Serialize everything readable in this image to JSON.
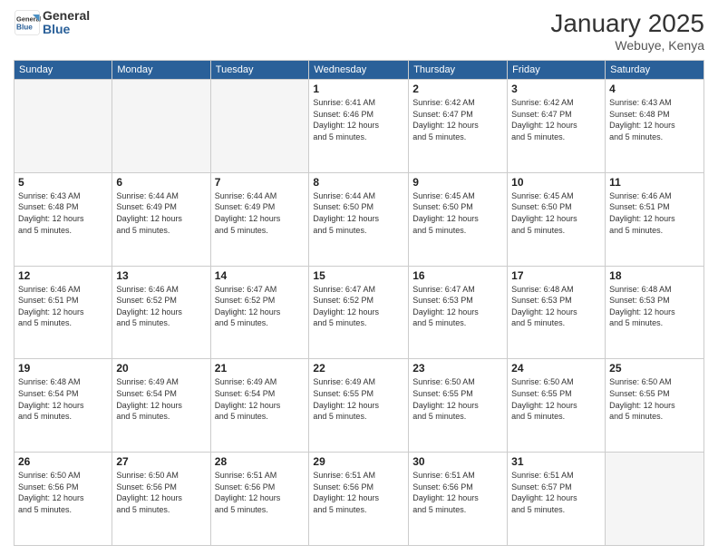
{
  "header": {
    "logo_line1": "General",
    "logo_line2": "Blue",
    "month": "January 2025",
    "location": "Webuye, Kenya"
  },
  "weekdays": [
    "Sunday",
    "Monday",
    "Tuesday",
    "Wednesday",
    "Thursday",
    "Friday",
    "Saturday"
  ],
  "weeks": [
    [
      {
        "day": "",
        "info": ""
      },
      {
        "day": "",
        "info": ""
      },
      {
        "day": "",
        "info": ""
      },
      {
        "day": "1",
        "info": "Sunrise: 6:41 AM\nSunset: 6:46 PM\nDaylight: 12 hours\nand 5 minutes."
      },
      {
        "day": "2",
        "info": "Sunrise: 6:42 AM\nSunset: 6:47 PM\nDaylight: 12 hours\nand 5 minutes."
      },
      {
        "day": "3",
        "info": "Sunrise: 6:42 AM\nSunset: 6:47 PM\nDaylight: 12 hours\nand 5 minutes."
      },
      {
        "day": "4",
        "info": "Sunrise: 6:43 AM\nSunset: 6:48 PM\nDaylight: 12 hours\nand 5 minutes."
      }
    ],
    [
      {
        "day": "5",
        "info": "Sunrise: 6:43 AM\nSunset: 6:48 PM\nDaylight: 12 hours\nand 5 minutes."
      },
      {
        "day": "6",
        "info": "Sunrise: 6:44 AM\nSunset: 6:49 PM\nDaylight: 12 hours\nand 5 minutes."
      },
      {
        "day": "7",
        "info": "Sunrise: 6:44 AM\nSunset: 6:49 PM\nDaylight: 12 hours\nand 5 minutes."
      },
      {
        "day": "8",
        "info": "Sunrise: 6:44 AM\nSunset: 6:50 PM\nDaylight: 12 hours\nand 5 minutes."
      },
      {
        "day": "9",
        "info": "Sunrise: 6:45 AM\nSunset: 6:50 PM\nDaylight: 12 hours\nand 5 minutes."
      },
      {
        "day": "10",
        "info": "Sunrise: 6:45 AM\nSunset: 6:50 PM\nDaylight: 12 hours\nand 5 minutes."
      },
      {
        "day": "11",
        "info": "Sunrise: 6:46 AM\nSunset: 6:51 PM\nDaylight: 12 hours\nand 5 minutes."
      }
    ],
    [
      {
        "day": "12",
        "info": "Sunrise: 6:46 AM\nSunset: 6:51 PM\nDaylight: 12 hours\nand 5 minutes."
      },
      {
        "day": "13",
        "info": "Sunrise: 6:46 AM\nSunset: 6:52 PM\nDaylight: 12 hours\nand 5 minutes."
      },
      {
        "day": "14",
        "info": "Sunrise: 6:47 AM\nSunset: 6:52 PM\nDaylight: 12 hours\nand 5 minutes."
      },
      {
        "day": "15",
        "info": "Sunrise: 6:47 AM\nSunset: 6:52 PM\nDaylight: 12 hours\nand 5 minutes."
      },
      {
        "day": "16",
        "info": "Sunrise: 6:47 AM\nSunset: 6:53 PM\nDaylight: 12 hours\nand 5 minutes."
      },
      {
        "day": "17",
        "info": "Sunrise: 6:48 AM\nSunset: 6:53 PM\nDaylight: 12 hours\nand 5 minutes."
      },
      {
        "day": "18",
        "info": "Sunrise: 6:48 AM\nSunset: 6:53 PM\nDaylight: 12 hours\nand 5 minutes."
      }
    ],
    [
      {
        "day": "19",
        "info": "Sunrise: 6:48 AM\nSunset: 6:54 PM\nDaylight: 12 hours\nand 5 minutes."
      },
      {
        "day": "20",
        "info": "Sunrise: 6:49 AM\nSunset: 6:54 PM\nDaylight: 12 hours\nand 5 minutes."
      },
      {
        "day": "21",
        "info": "Sunrise: 6:49 AM\nSunset: 6:54 PM\nDaylight: 12 hours\nand 5 minutes."
      },
      {
        "day": "22",
        "info": "Sunrise: 6:49 AM\nSunset: 6:55 PM\nDaylight: 12 hours\nand 5 minutes."
      },
      {
        "day": "23",
        "info": "Sunrise: 6:50 AM\nSunset: 6:55 PM\nDaylight: 12 hours\nand 5 minutes."
      },
      {
        "day": "24",
        "info": "Sunrise: 6:50 AM\nSunset: 6:55 PM\nDaylight: 12 hours\nand 5 minutes."
      },
      {
        "day": "25",
        "info": "Sunrise: 6:50 AM\nSunset: 6:55 PM\nDaylight: 12 hours\nand 5 minutes."
      }
    ],
    [
      {
        "day": "26",
        "info": "Sunrise: 6:50 AM\nSunset: 6:56 PM\nDaylight: 12 hours\nand 5 minutes."
      },
      {
        "day": "27",
        "info": "Sunrise: 6:50 AM\nSunset: 6:56 PM\nDaylight: 12 hours\nand 5 minutes."
      },
      {
        "day": "28",
        "info": "Sunrise: 6:51 AM\nSunset: 6:56 PM\nDaylight: 12 hours\nand 5 minutes."
      },
      {
        "day": "29",
        "info": "Sunrise: 6:51 AM\nSunset: 6:56 PM\nDaylight: 12 hours\nand 5 minutes."
      },
      {
        "day": "30",
        "info": "Sunrise: 6:51 AM\nSunset: 6:56 PM\nDaylight: 12 hours\nand 5 minutes."
      },
      {
        "day": "31",
        "info": "Sunrise: 6:51 AM\nSunset: 6:57 PM\nDaylight: 12 hours\nand 5 minutes."
      },
      {
        "day": "",
        "info": ""
      }
    ]
  ]
}
